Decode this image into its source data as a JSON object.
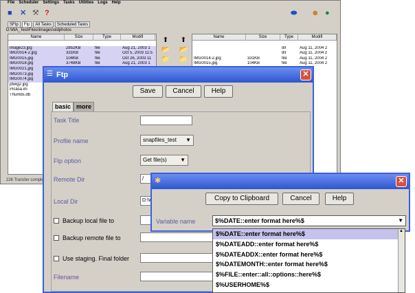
{
  "menu": [
    "File",
    "Scheduler",
    "Settings",
    "Tasks",
    "Utilities",
    "Logs",
    "Help"
  ],
  "app_tabs": [
    "SFtp",
    "Ftp",
    "All Tasks",
    "Scheduled Tasks"
  ],
  "local_path": "D:\\WA_Test\\Files\\Images\\oldphotos",
  "columns": [
    "Name",
    "Size",
    "Type",
    "Modifi"
  ],
  "left_files": [
    {
      "name": "",
      "size": "",
      "type": "",
      "mod": ""
    },
    {
      "name": "image23.jpg",
      "size": "2852KB",
      "type": "file",
      "mod": "Aug 21, 2003 1"
    },
    {
      "name": "IMG0014-2.jpg",
      "size": "331KB",
      "type": "file",
      "mod": "Oct 5, 2003 11:5"
    },
    {
      "name": "IMG0015.jpg",
      "size": "104KB",
      "type": "file",
      "mod": "Oct 26, 2003 11"
    },
    {
      "name": "IMG0018.jpg",
      "size": "3748KB",
      "type": "file",
      "mod": "Aug 21, 2003 1"
    },
    {
      "name": "IMG0021.jpg",
      "size": "",
      "type": "",
      "mod": ""
    },
    {
      "name": "IMG0073.jpg",
      "size": "",
      "type": "",
      "mod": ""
    },
    {
      "name": "IMG0074.jpg",
      "size": "",
      "type": "",
      "mod": ""
    },
    {
      "name": "jdwig2.jpg",
      "size": "",
      "type": "",
      "mod": ""
    },
    {
      "name": "Picasa.ini",
      "size": "",
      "type": "",
      "mod": ""
    },
    {
      "name": "Thumbs.db",
      "size": "",
      "type": "",
      "mod": ""
    }
  ],
  "right_files": [
    {
      "name": "",
      "size": "",
      "type": "",
      "mod": ""
    },
    {
      "name": "",
      "size": "",
      "type": "dir",
      "mod": "Aug 11, 2004 2"
    },
    {
      "name": "",
      "size": "",
      "type": "dir",
      "mod": "Aug 11, 2004 2"
    },
    {
      "name": "IMG0014-2.jpg",
      "size": "331KB",
      "type": "file",
      "mod": "Aug 11, 2004 2"
    },
    {
      "name": "IMG0015.jpg",
      "size": "104KB",
      "type": "file",
      "mod": "Aug 11, 2004 2"
    }
  ],
  "status": "226 Transfer complete",
  "ftp_dialog": {
    "title": "Ftp",
    "buttons": {
      "save": "Save",
      "cancel": "Cancel",
      "help": "Help"
    },
    "tabs": [
      "basic",
      "more"
    ],
    "labels": {
      "task_title": "Task Title",
      "profile_name": "Profile name",
      "ftp_option": "Ftp option",
      "remote_dir": "Remote Dir",
      "local_dir": "Local Dir",
      "backup_local": "Backup local file to",
      "backup_remote": "Backup remote file to",
      "staging": "Use staging.  Final folder",
      "filename": "Filename"
    },
    "values": {
      "profile_name": "snapfiles_test",
      "ftp_option": "Get file(s)",
      "remote_dir": "/",
      "local_dir": "D:\\W"
    }
  },
  "var_dialog": {
    "buttons": {
      "copy": "Copy to Clipboard",
      "cancel": "Cancel",
      "help": "Help"
    },
    "label": "Variable name",
    "selected": "$%DATE::enter format here%$",
    "options": [
      "$%DATE::enter format here%$",
      "$%DATEADD::enter format here%$",
      "$%DATEADDX::enter format here%$",
      "$%DATEMONTH::enter format here%$",
      "$%FILE::enter::all::options::here%$",
      "$%USERHOME%$"
    ]
  },
  "colors": {
    "titlebar": "#2d55d0",
    "close": "#d9503a",
    "selection": "#c6c2ee"
  }
}
